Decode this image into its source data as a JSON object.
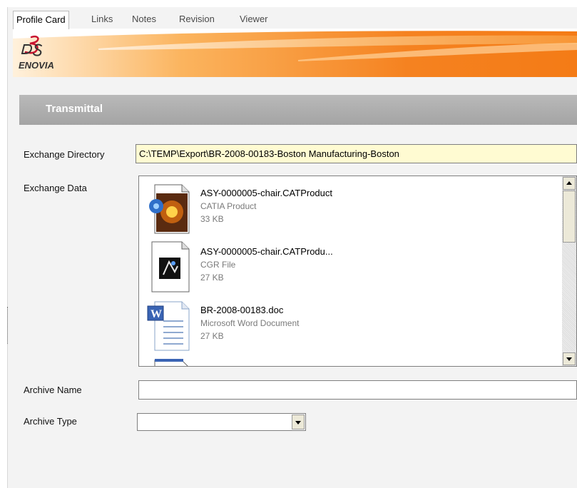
{
  "tabs": [
    {
      "label": "Profile Card",
      "active": true
    },
    {
      "label": "Links",
      "active": false
    },
    {
      "label": "Notes",
      "active": false
    },
    {
      "label": "Revision",
      "active": false
    },
    {
      "label": "Viewer",
      "active": false
    }
  ],
  "brand": {
    "logo_text": "ENOVIA",
    "logo_mark": "3DS"
  },
  "section": {
    "title": "Transmittal"
  },
  "form": {
    "exchange_directory": {
      "label": "Exchange Directory",
      "value": "C:\\TEMP\\Export\\BR-2008-00183-Boston Manufacturing-Boston"
    },
    "exchange_data": {
      "label": "Exchange Data",
      "files": [
        {
          "name": "ASY-0000005-chair.CATProduct",
          "type": "CATIA Product",
          "size": "33 KB",
          "icon": "catia-product-icon"
        },
        {
          "name": "ASY-0000005-chair.CATProdu...",
          "type": "CGR File",
          "size": "27 KB",
          "icon": "cgr-file-icon"
        },
        {
          "name": "BR-2008-00183.doc",
          "type": "Microsoft Word Document",
          "size": "27 KB",
          "icon": "word-document-icon"
        }
      ]
    },
    "archive_name": {
      "label": "Archive Name",
      "value": ""
    },
    "archive_type": {
      "label": "Archive Type",
      "value": ""
    }
  },
  "colors": {
    "banner_orange": "#f58220",
    "header_gray": "#a8a8a8",
    "directory_field_bg": "#fffbd2"
  }
}
